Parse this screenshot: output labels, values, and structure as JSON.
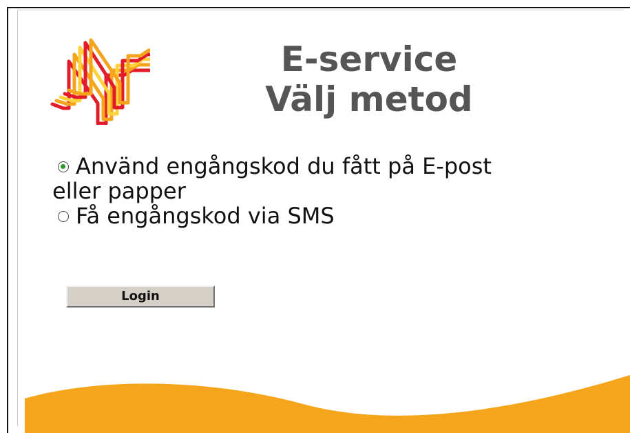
{
  "page": {
    "brand_color": "#F5A51B",
    "logo_colors": [
      "#E21C2A",
      "#F5A51B",
      "#FFD33D"
    ],
    "title_line1": "E-service",
    "title_line2": "Välj metod"
  },
  "login_options": [
    {
      "label": "Använd engångskod du fått på E-post",
      "label_continuation": "eller papper",
      "selected": true
    },
    {
      "label": "Få engångskod via SMS",
      "selected": false
    }
  ],
  "buttons": {
    "login": "Login"
  },
  "icons": {
    "logo": "n-logo-icon",
    "selected_radio": "radio-selected-icon",
    "unselected_radio": "radio-unselected-icon"
  }
}
